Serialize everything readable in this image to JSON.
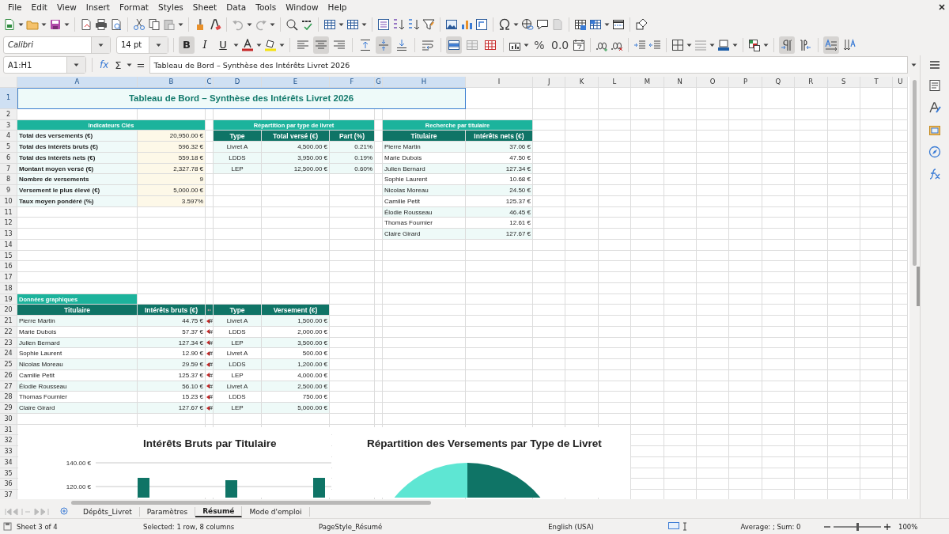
{
  "menu_bar": [
    "File",
    "Edit",
    "View",
    "Insert",
    "Format",
    "Styles",
    "Sheet",
    "Data",
    "Tools",
    "Window",
    "Help"
  ],
  "formatting_toolbar": {
    "font_name": "Calibri",
    "font_size": "14 pt",
    "items": [
      {
        "kind": "bold",
        "label": "B",
        "on": true
      },
      {
        "kind": "italic",
        "label": "I",
        "on": false
      },
      {
        "kind": "underline",
        "label": "U",
        "on": false
      },
      {
        "kind": "font-color"
      },
      {
        "kind": "highlight"
      },
      {
        "kind": "align-left",
        "on": false
      },
      {
        "kind": "align-center",
        "on": true
      },
      {
        "kind": "align-right",
        "on": false
      },
      {
        "kind": "align-top",
        "on": false
      },
      {
        "kind": "align-middle",
        "on": true
      },
      {
        "kind": "align-bottom",
        "on": false
      },
      {
        "kind": "wrap",
        "on": false
      },
      {
        "kind": "merge-center",
        "on": true
      },
      {
        "kind": "merge",
        "on": false
      },
      {
        "kind": "unmerge",
        "on": false
      },
      {
        "kind": "number-format"
      },
      {
        "kind": "percent",
        "label": "%"
      },
      {
        "kind": "decimal",
        "label": "0.0"
      },
      {
        "kind": "date"
      },
      {
        "kind": "add-decimal"
      },
      {
        "kind": "delete-decimal"
      },
      {
        "kind": "indent"
      },
      {
        "kind": "outdent"
      },
      {
        "kind": "borders"
      },
      {
        "kind": "border-style"
      },
      {
        "kind": "border-color"
      },
      {
        "kind": "conditional"
      },
      {
        "kind": "ltr",
        "on": true
      },
      {
        "kind": "rtl",
        "on": false
      },
      {
        "kind": "text-horizontal",
        "on": true
      },
      {
        "kind": "text-vertical",
        "on": false
      }
    ]
  },
  "formula_bar": {
    "name_box": "A1:H1",
    "function_wizard": "fx",
    "sum": "Σ",
    "formula": "=",
    "content": "Tableau de Bord – Synthèse des Intérêts Livret 2026"
  },
  "sheet": {
    "columns": [
      {
        "label": "A",
        "selected": true
      },
      {
        "label": "B",
        "selected": true
      },
      {
        "label": "C",
        "selected": true
      },
      {
        "label": "D",
        "selected": true
      },
      {
        "label": "E",
        "selected": true
      },
      {
        "label": "F",
        "selected": true
      },
      {
        "label": "G",
        "selected": true
      },
      {
        "label": "H",
        "selected": true
      },
      {
        "label": "I",
        "selected": false
      },
      {
        "label": "J",
        "selected": false
      },
      {
        "label": "K",
        "selected": false
      },
      {
        "label": "L",
        "selected": false
      },
      {
        "label": "M",
        "selected": false
      },
      {
        "label": "N",
        "selected": false
      },
      {
        "label": "O",
        "selected": false
      },
      {
        "label": "P",
        "selected": false
      },
      {
        "label": "Q",
        "selected": false
      },
      {
        "label": "R",
        "selected": false
      },
      {
        "label": "S",
        "selected": false
      },
      {
        "label": "T",
        "selected": false
      },
      {
        "label": "U",
        "selected": false
      }
    ],
    "rows": [
      {
        "label": "1",
        "selected": true
      },
      {
        "label": "2",
        "selected": false
      },
      {
        "label": "3",
        "selected": false
      },
      {
        "label": "4",
        "selected": false
      },
      {
        "label": "5",
        "selected": false
      },
      {
        "label": "6",
        "selected": false
      },
      {
        "label": "7",
        "selected": false
      },
      {
        "label": "8",
        "selected": false
      },
      {
        "label": "9",
        "selected": false
      },
      {
        "label": "10",
        "selected": false
      },
      {
        "label": "11",
        "selected": false
      },
      {
        "label": "12",
        "selected": false
      },
      {
        "label": "13",
        "selected": false
      },
      {
        "label": "14",
        "selected": false
      },
      {
        "label": "15",
        "selected": false
      },
      {
        "label": "16",
        "selected": false
      },
      {
        "label": "17",
        "selected": false
      },
      {
        "label": "18",
        "selected": false
      },
      {
        "label": "19",
        "selected": false
      },
      {
        "label": "20",
        "selected": false
      },
      {
        "label": "21",
        "selected": false
      },
      {
        "label": "22",
        "selected": false
      },
      {
        "label": "23",
        "selected": false
      },
      {
        "label": "24",
        "selected": false
      },
      {
        "label": "25",
        "selected": false
      },
      {
        "label": "26",
        "selected": false
      },
      {
        "label": "27",
        "selected": false
      },
      {
        "label": "28",
        "selected": false
      },
      {
        "label": "29",
        "selected": false
      },
      {
        "label": "30",
        "selected": false
      },
      {
        "label": "31",
        "selected": false
      },
      {
        "label": "32",
        "selected": false
      },
      {
        "label": "33",
        "selected": false
      },
      {
        "label": "34",
        "selected": false
      },
      {
        "label": "35",
        "selected": false
      },
      {
        "label": "36",
        "selected": false
      },
      {
        "label": "37",
        "selected": false
      }
    ],
    "title": "Tableau de Bord – Synthèse des Intérêts Livret 2026",
    "key_indicators": {
      "heading": "Indicateurs Clés",
      "rows": [
        {
          "label": "Total des versements (€)",
          "value": "20,950.00 €"
        },
        {
          "label": "Total des intérêts bruts (€)",
          "value": "596.32 €"
        },
        {
          "label": "Total des intérêts nets (€)",
          "value": "559.18 €"
        },
        {
          "label": "Montant moyen versé (€)",
          "value": "2,327.78 €"
        },
        {
          "label": "Nombre de versements",
          "value": "9"
        },
        {
          "label": "Versement le plus élevé (€)",
          "value": "5,000.00 €"
        },
        {
          "label": "Taux moyen pondéré (%)",
          "value": "3.597%"
        }
      ]
    },
    "type_breakdown": {
      "heading": "Répartition par type de livret",
      "columns": [
        "Type",
        "Total versé (€)",
        "Part (%)"
      ],
      "rows": [
        [
          "Livret A",
          "4,500.00 €",
          "0.21%"
        ],
        [
          "LDDS",
          "3,950.00 €",
          "0.19%"
        ],
        [
          "LEP",
          "12,500.00 €",
          "0.60%"
        ]
      ]
    },
    "holder_lookup": {
      "heading": "Recherche par titulaire",
      "columns": [
        "Titulaire",
        "Intérêts nets (€)"
      ],
      "rows": [
        [
          "Pierre Martin",
          "37.06 €"
        ],
        [
          "Marie Dubois",
          "47.50 €"
        ],
        [
          "Julien Bernard",
          "127.34 €"
        ],
        [
          "Sophie Laurent",
          "10.68 €"
        ],
        [
          "Nicolas Moreau",
          "24.50 €"
        ],
        [
          "Camille Petit",
          "125.37 €"
        ],
        [
          "Élodie Rousseau",
          "46.45 €"
        ],
        [
          "Thomas Fournier",
          "12.61 €"
        ],
        [
          "Claire Girard",
          "127.67 €"
        ]
      ]
    },
    "chart_source": {
      "heading": "Données graphiques",
      "columns": [
        "Titulaire",
        "Intérêts bruts (€)",
        "Type",
        "Versement (€)"
      ],
      "rows": [
        {
          "titulaire": "Pierre Martin",
          "interets": "44.75 €",
          "column_3": "#",
          "type": "Livret A",
          "versement": "1,500.00 €"
        },
        {
          "titulaire": "Marie Dubois",
          "interets": "57.37 €",
          "column_3": "#",
          "type": "LDDS",
          "versement": "2,000.00 €"
        },
        {
          "titulaire": "Julien Bernard",
          "interets": "127.34 €",
          "column_3": "#",
          "type": "LEP",
          "versement": "3,500.00 €"
        },
        {
          "titulaire": "Sophie Laurent",
          "interets": "12.90 €",
          "column_3": "#",
          "type": "Livret A",
          "versement": "500.00 €"
        },
        {
          "titulaire": "Nicolas Moreau",
          "interets": "29.59 €",
          "column_3": "#",
          "type": "LDDS",
          "versement": "1,200.00 €"
        },
        {
          "titulaire": "Camille Petit",
          "interets": "125.37 €",
          "column_3": "#",
          "type": "LEP",
          "versement": "4,000.00 €"
        },
        {
          "titulaire": "Élodie Rousseau",
          "interets": "56.10 €",
          "column_3": "#",
          "type": "Livret A",
          "versement": "2,500.00 €"
        },
        {
          "titulaire": "Thomas Fournier",
          "interets": "15.23 €",
          "column_3": "#",
          "type": "LDDS",
          "versement": "750.00 €"
        },
        {
          "titulaire": "Claire Girard",
          "interets": "127.67 €",
          "column_3": "#",
          "type": "LEP",
          "versement": "5,000.00 €"
        }
      ]
    },
    "charts": [
      {
        "kind": "bar",
        "title": "Intérêts Bruts par Titulaire",
        "axis_labels": [
          "140.00 €",
          "120.00 €"
        ]
      },
      {
        "kind": "pie",
        "title": "Répartition des Versements par Type de Livret"
      }
    ]
  },
  "sheet_tabs": [
    {
      "label": "Dépôts_Livret",
      "selected": false
    },
    {
      "label": "Paramètres",
      "selected": false
    },
    {
      "label": "Résumé",
      "selected": true
    },
    {
      "label": "Mode d'emploi",
      "selected": false
    }
  ],
  "status_bar": {
    "sheet": "Sheet 3 of 4",
    "selection": "Selected: 1 row, 8 columns",
    "page_style": "PageStyle_Résumé",
    "language": "English (USA)",
    "summary": "Average: ; Sum: 0",
    "zoom": {
      "level": 0.5,
      "reading": "100%"
    }
  }
}
